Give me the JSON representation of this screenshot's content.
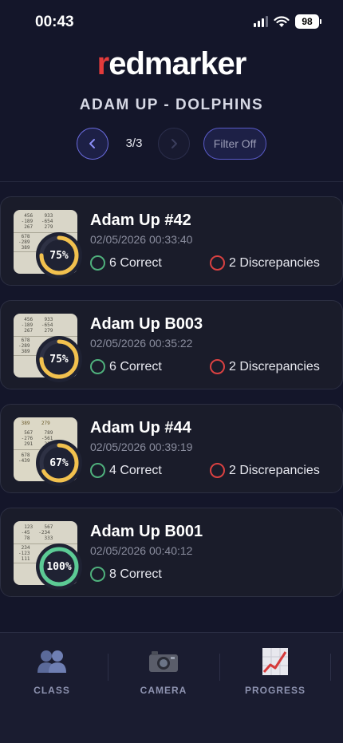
{
  "status_bar": {
    "time": "00:43",
    "battery": "98"
  },
  "header": {
    "logo_r": "r",
    "logo_rest": "edmarker",
    "class_title": "ADAM UP - DOLPHINS",
    "page_indicator": "3/3",
    "filter_label": "Filter Off"
  },
  "cards": [
    {
      "title": "Adam Up #42",
      "date": "02/05/2026 00:33:40",
      "percent": "75%",
      "score": 0.75,
      "ring_color": "#f2c14e",
      "correct": "6 Correct",
      "discrepancies": "2 Discrepancies"
    },
    {
      "title": "Adam Up B003",
      "date": "02/05/2026 00:35:22",
      "percent": "75%",
      "score": 0.75,
      "ring_color": "#f2c14e",
      "correct": "6 Correct",
      "discrepancies": "2 Discrepancies"
    },
    {
      "title": "Adam Up #44",
      "date": "02/05/2026 00:39:19",
      "percent": "67%",
      "score": 0.67,
      "ring_color": "#f2c14e",
      "correct": "4 Correct",
      "discrepancies": "2 Discrepancies"
    },
    {
      "title": "Adam Up B001",
      "date": "02/05/2026 00:40:12",
      "percent": "100%",
      "score": 1.0,
      "ring_color": "#5ccb95",
      "correct": "8 Correct",
      "discrepancies": ""
    }
  ],
  "tabs": [
    {
      "label": "CLASS",
      "icon": "class-people-icon"
    },
    {
      "label": "CAMERA",
      "icon": "camera-icon"
    },
    {
      "label": "PROGRESS",
      "icon": "progress-chart-icon"
    }
  ],
  "colors": {
    "brand_red": "#e33b3b",
    "accent": "#6b6ce0",
    "correct": "#4fb07c",
    "discrepancy": "#d94141"
  }
}
